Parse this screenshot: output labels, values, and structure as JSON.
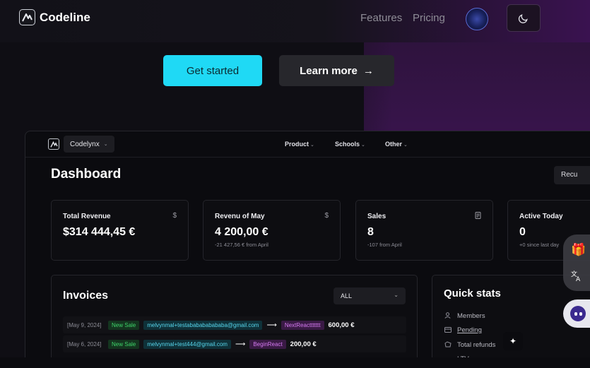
{
  "nav": {
    "brand": "Codeline",
    "links": [
      "Features",
      "Pricing"
    ]
  },
  "hero": {
    "primary_label": "Get started",
    "secondary_label": "Learn more",
    "secondary_arrow": "→"
  },
  "dashboard": {
    "team": "Codelynx",
    "menu": [
      "Product",
      "Schools",
      "Other"
    ],
    "title": "Dashboard",
    "action_label": "Recu",
    "stats": [
      {
        "label": "Total Revenue",
        "icon": "$",
        "value": "$314 444,45 €",
        "sub": ""
      },
      {
        "label": "Revenu of May",
        "icon": "$",
        "value": "4 200,00 €",
        "sub": "-21 427,56 € from April"
      },
      {
        "label": "Sales",
        "icon": "receipt-icon",
        "value": "8",
        "sub": "-107 from April"
      },
      {
        "label": "Active Today",
        "icon": "",
        "value": "0",
        "sub": "+0 since last day"
      }
    ],
    "invoices": {
      "title": "Invoices",
      "filter": "ALL",
      "rows": [
        {
          "date": "[May 9, 2024]",
          "type": "New Sale",
          "email": "melvynmal+testababababababa@gmail.com",
          "product": "NextReacttttttt",
          "amount": "600,00 €"
        },
        {
          "date": "[May 6, 2024]",
          "type": "New Sale",
          "email": "melvynmal+test444@gmail.com",
          "product": "BeginReact",
          "amount": "200,00 €"
        }
      ]
    },
    "quick_stats": {
      "title": "Quick stats",
      "items": [
        "Members",
        "Pending",
        "Total refunds",
        "LTV"
      ]
    }
  },
  "colors": {
    "accent": "#1fd9f5",
    "background": "#0f0e14",
    "purple_glow": "#3b1550"
  }
}
